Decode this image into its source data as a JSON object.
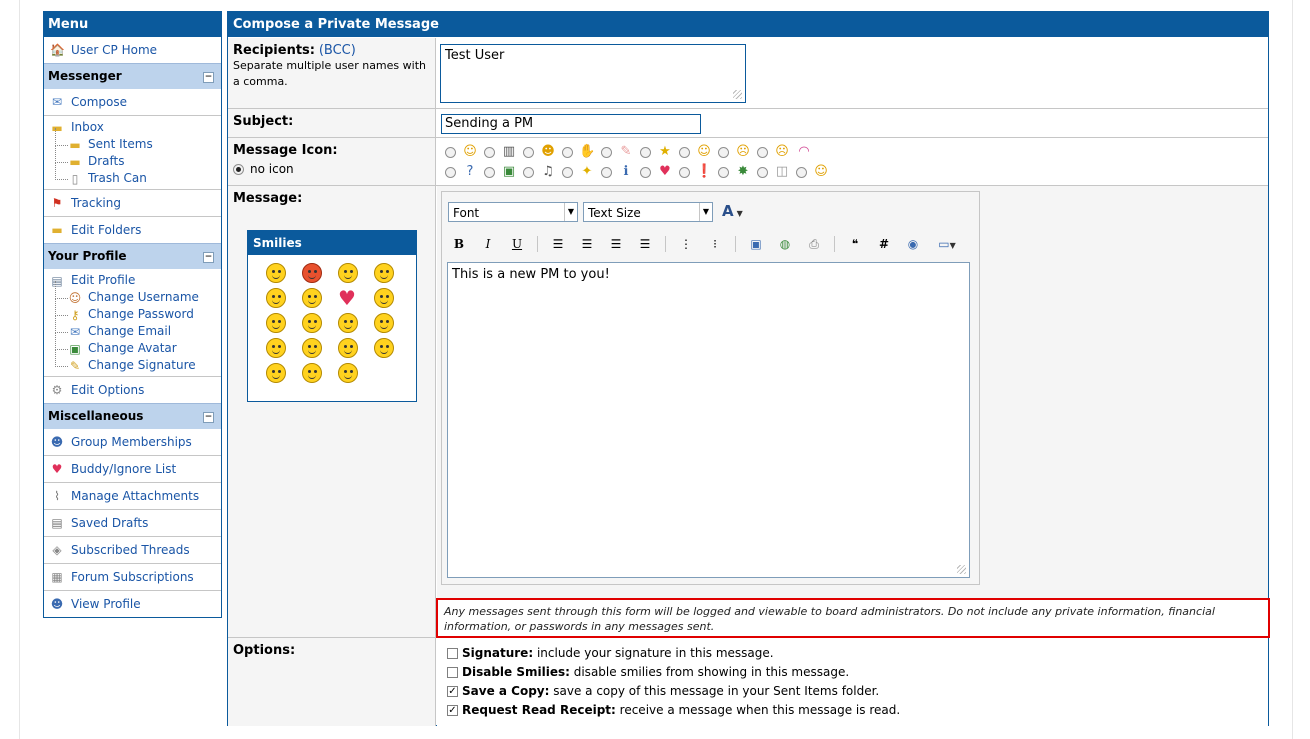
{
  "sidebar": {
    "title": "Menu",
    "user_cp_home": "User CP Home",
    "sections": {
      "messenger": "Messenger",
      "your_profile": "Your Profile",
      "misc": "Miscellaneous"
    },
    "toggle_glyph": "−",
    "messenger": {
      "compose": "Compose",
      "inbox": "Inbox",
      "sent_items": "Sent Items",
      "drafts": "Drafts",
      "trash": "Trash Can",
      "tracking": "Tracking",
      "edit_folders": "Edit Folders"
    },
    "profile": {
      "edit_profile": "Edit Profile",
      "change_username": "Change Username",
      "change_password": "Change Password",
      "change_email": "Change Email",
      "change_avatar": "Change Avatar",
      "change_signature": "Change Signature",
      "edit_options": "Edit Options"
    },
    "misc": {
      "group_memberships": "Group Memberships",
      "buddy_ignore": "Buddy/Ignore List",
      "manage_attachments": "Manage Attachments",
      "saved_drafts": "Saved Drafts",
      "subscribed_threads": "Subscribed Threads",
      "forum_subscriptions": "Forum Subscriptions",
      "view_profile": "View Profile"
    }
  },
  "compose": {
    "title": "Compose a Private Message",
    "recipients_label": "Recipients:",
    "bcc_link": "(BCC)",
    "recipients_help": "Separate multiple user names with a comma.",
    "recipients_value": "Test User",
    "subject_label": "Subject:",
    "subject_value": "Sending a PM",
    "icon_label": "Message Icon:",
    "no_icon": "no icon",
    "message_label": "Message:",
    "font_select": "Font",
    "size_select": "Text Size",
    "message_value": "This is a new PM to you!",
    "smilies_title": "Smilies",
    "warning": "Any messages sent through this form will be logged and viewable to board administrators. Do not include any private information, financial information, or passwords in any messages sent.",
    "options_label": "Options:",
    "options": [
      {
        "bold": "Signature:",
        "text": "include your signature in this message.",
        "checked": false
      },
      {
        "bold": "Disable Smilies:",
        "text": "disable smilies from showing in this message.",
        "checked": false
      },
      {
        "bold": "Save a Copy:",
        "text": "save a copy of this message in your Sent Items folder.",
        "checked": true
      },
      {
        "bold": "Request Read Receipt:",
        "text": "receive a message when this message is read.",
        "checked": true
      }
    ]
  },
  "colors": {
    "header_blue": "#0b5a9c",
    "section_blue": "#bdd3ec",
    "link_blue": "#1a55a6",
    "warning_border": "#e00000"
  }
}
